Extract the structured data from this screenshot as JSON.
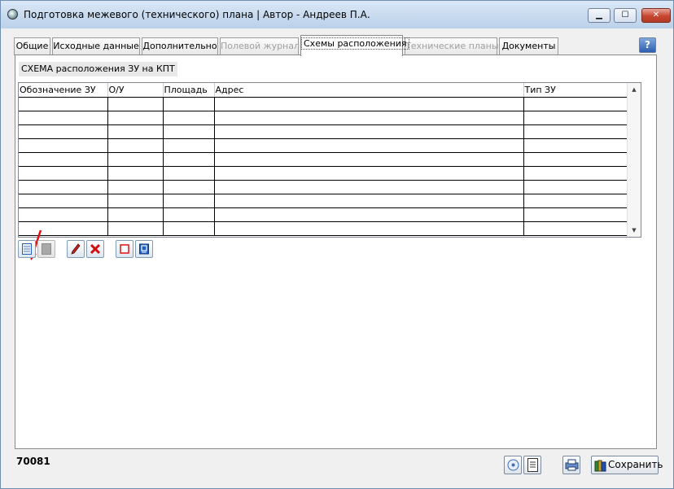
{
  "window": {
    "title": "Подготовка межевого (технического) плана | Автор - Андреев П.А.",
    "controls": {
      "minimize": "▁",
      "maximize": "☐",
      "close": "✕"
    }
  },
  "tabs": [
    {
      "label": "Общие",
      "state": "normal"
    },
    {
      "label": "Исходные данные",
      "state": "normal"
    },
    {
      "label": "Дополнительно",
      "state": "normal"
    },
    {
      "label": "Полевой журнал",
      "state": "disabled"
    },
    {
      "label": "Схемы расположения",
      "state": "active"
    },
    {
      "label": "Технические планы",
      "state": "disabled"
    },
    {
      "label": "Документы",
      "state": "normal"
    }
  ],
  "help": {
    "label": "?"
  },
  "section": {
    "label": "СХЕМА расположения ЗУ на КПТ"
  },
  "grid": {
    "columns": [
      "Обозначение ЗУ",
      "О/У",
      "Площадь",
      "Адрес",
      "Тип ЗУ"
    ],
    "rows": [
      [
        "",
        "",
        "",
        "",
        ""
      ],
      [
        "",
        "",
        "",
        "",
        ""
      ],
      [
        "",
        "",
        "",
        "",
        ""
      ],
      [
        "",
        "",
        "",
        "",
        ""
      ],
      [
        "",
        "",
        "",
        "",
        ""
      ],
      [
        "",
        "",
        "",
        "",
        ""
      ],
      [
        "",
        "",
        "",
        "",
        ""
      ],
      [
        "",
        "",
        "",
        "",
        ""
      ],
      [
        "",
        "",
        "",
        "",
        ""
      ],
      [
        "",
        "",
        "",
        "",
        ""
      ]
    ]
  },
  "toolbar": {
    "buttons": [
      {
        "icon": "new-document-icon",
        "enabled": true
      },
      {
        "icon": "blank-gray-icon",
        "enabled": false
      },
      {
        "icon": "pencil-edit-icon",
        "enabled": true
      },
      {
        "icon": "red-x-delete-icon",
        "enabled": true
      },
      {
        "icon": "red-square-icon",
        "enabled": true
      },
      {
        "icon": "blue-info-icon",
        "enabled": true
      }
    ]
  },
  "footer": {
    "code": "70081",
    "save_label": "Сохранить"
  },
  "colors": {
    "accent_red": "#e01010",
    "title_gradient": "#c6d9ee",
    "panel_border": "#8a8a8a"
  }
}
